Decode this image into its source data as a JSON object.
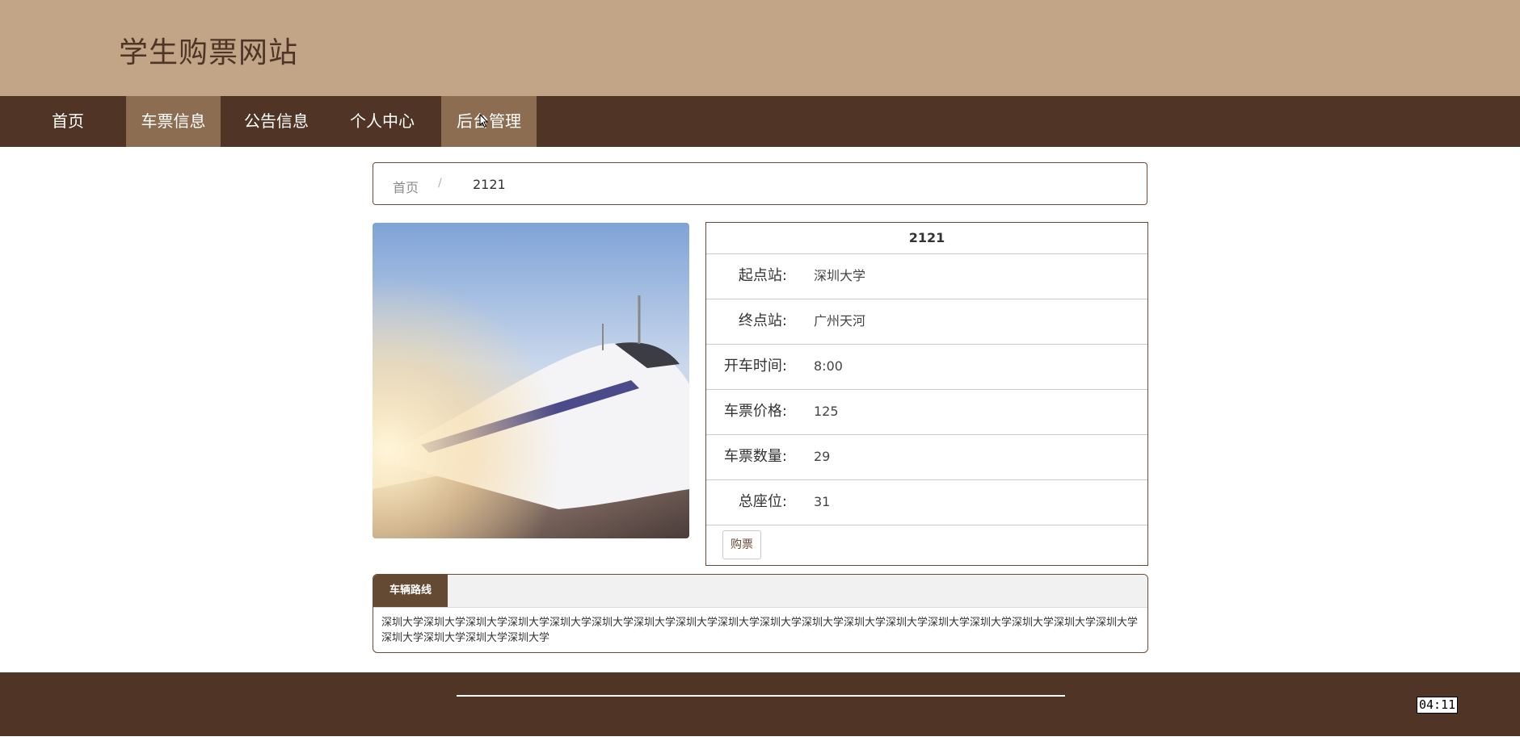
{
  "header": {
    "site_title": "学生购票网站"
  },
  "nav": {
    "items": [
      {
        "label": "首页",
        "active": false
      },
      {
        "label": "车票信息",
        "active": true
      },
      {
        "label": "公告信息",
        "active": false
      },
      {
        "label": "个人中心",
        "active": false
      },
      {
        "label": "后台管理",
        "active": false
      }
    ]
  },
  "breadcrumb": {
    "home": "首页",
    "separator": "/",
    "current": "2121"
  },
  "ticket": {
    "title": "2121",
    "rows": [
      {
        "label": "起点站:",
        "value": "深圳大学"
      },
      {
        "label": "终点站:",
        "value": "广州天河"
      },
      {
        "label": "开车时间:",
        "value": "8:00"
      },
      {
        "label": "车票价格:",
        "value": "125"
      },
      {
        "label": "车票数量:",
        "value": "29"
      },
      {
        "label": "总座位:",
        "value": "31"
      }
    ],
    "buy_label": "购票"
  },
  "route": {
    "tab_label": "车辆路线",
    "text": "深圳大学深圳大学深圳大学深圳大学深圳大学深圳大学深圳大学深圳大学深圳大学深圳大学深圳大学深圳大学深圳大学深圳大学深圳大学深圳大学深圳大学深圳大学深圳大学深圳大学深圳大学深圳大学"
  },
  "footer": {
    "clock": "04:11"
  },
  "colors": {
    "header_bg": "#c2a587",
    "nav_bg": "#503426",
    "nav_active": "#8c6d52",
    "accent": "#6b4b36"
  },
  "icons": {
    "cursor": "arrow-cursor-icon",
    "photo": "high-speed-train-photo"
  }
}
